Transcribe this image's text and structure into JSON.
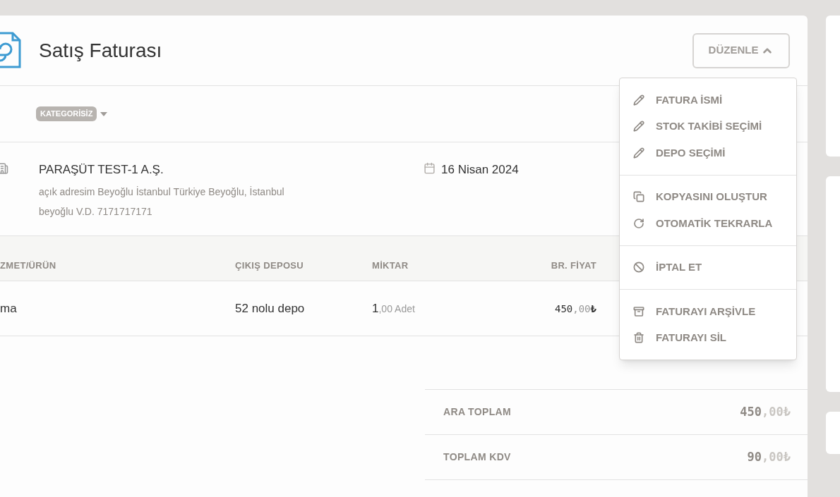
{
  "header": {
    "title": "Satış Faturası",
    "edit_button": {
      "label": "DÜZENLE",
      "expanded": true
    }
  },
  "category": {
    "label": "KATEGORİSİZ"
  },
  "customer": {
    "name": "PARAŞÜT TEST-1 A.Ş.",
    "address": "açık adresim Beyoğlu İstanbul Türkiye Beyoğlu, İstanbul",
    "tax": "beyoğlu V.D. 7171717171",
    "date": "16 Nisan 2024"
  },
  "table": {
    "columns": [
      "ZMET/ÜRÜN",
      "ÇIKIŞ DEPOSU",
      "MİKTAR",
      "BR. FİYAT"
    ],
    "rows": [
      {
        "item": "ma",
        "warehouse": "52 nolu depo",
        "quantity": {
          "whole": "1",
          "fraction": ",00",
          "unit": "Adet"
        },
        "price": {
          "whole": "450",
          "fraction": ",00",
          "currency": "₺"
        }
      }
    ]
  },
  "totals": [
    {
      "label": "ARA TOPLAM",
      "whole": "450",
      "fraction": ",00",
      "currency": "₺"
    },
    {
      "label": "TOPLAM KDV",
      "whole": "90",
      "fraction": ",00",
      "currency": "₺"
    }
  ],
  "menu": [
    [
      {
        "label": "FATURA İSMİ",
        "kind": "pencil"
      },
      {
        "label": "STOK TAKİBİ SEÇİMİ",
        "kind": "pencil"
      },
      {
        "label": "DEPO SEÇİMİ",
        "kind": "pencil"
      }
    ],
    [
      {
        "label": "KOPYASINI OLUŞTUR",
        "kind": "copy"
      },
      {
        "label": "OTOMATİK TEKRARLA",
        "kind": "repeat"
      }
    ],
    [
      {
        "label": "İPTAL ET",
        "kind": "ban"
      }
    ],
    [
      {
        "label": "FATURAYI ARŞİVLE",
        "kind": "archive"
      },
      {
        "label": "FATURAYI SİL",
        "kind": "trash"
      }
    ]
  ]
}
